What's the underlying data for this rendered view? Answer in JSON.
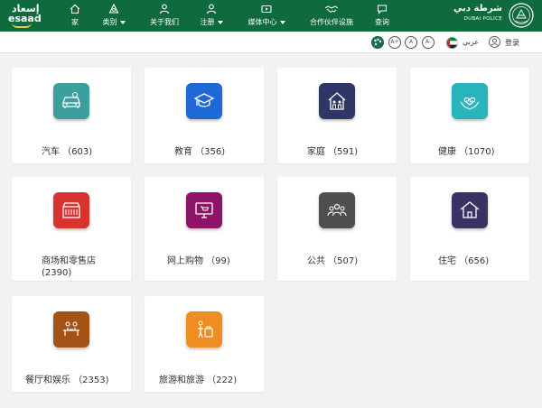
{
  "brand": {
    "logo_ar": "إسعاد",
    "logo_en": "esaad"
  },
  "nav": [
    {
      "label": "家",
      "icon": "home-icon"
    },
    {
      "label": "类别",
      "icon": "categories-icon"
    },
    {
      "label": "关于我们",
      "icon": "user-icon"
    },
    {
      "label": "注册",
      "icon": "register-icon"
    },
    {
      "label": "媒体中心",
      "icon": "media-icon"
    },
    {
      "label": "合作伙伴设施",
      "icon": "handshake-icon"
    },
    {
      "label": "查询",
      "icon": "chat-icon"
    }
  ],
  "police": {
    "name_ar": "شرطة دبي",
    "name_en": "DUBAI POLICE"
  },
  "utility": {
    "font_increase": "A+",
    "font_reset": "A",
    "font_decrease": "A-",
    "language": "عربي",
    "login": "登录"
  },
  "categories": [
    {
      "label": "汽车 （603)",
      "color": "#3a9f9d",
      "icon": "car-icon"
    },
    {
      "label": "教育 （356)",
      "color": "#1f69d6",
      "icon": "graduation-cap-icon"
    },
    {
      "label": "家庭 （591)",
      "color": "#2e3768",
      "icon": "family-home-icon"
    },
    {
      "label": "健康 （1070)",
      "color": "#29b4bb",
      "icon": "health-heart-icon"
    },
    {
      "label": "商场和零售店\n(2390)",
      "color": "#d8332e",
      "icon": "mall-icon"
    },
    {
      "label": "网上购物 （99)",
      "color": "#8d1468",
      "icon": "online-shopping-icon"
    },
    {
      "label": "公共 （507)",
      "color": "#4f4f52",
      "icon": "public-group-icon"
    },
    {
      "label": "住宅 （656)",
      "color": "#3b3263",
      "icon": "residence-icon"
    },
    {
      "label": "餐厅和娱乐 （2353)",
      "color": "#a35316",
      "icon": "restaurant-icon"
    },
    {
      "label": "旅游和旅游 （222)",
      "color": "#f08d22",
      "icon": "travel-icon"
    }
  ]
}
